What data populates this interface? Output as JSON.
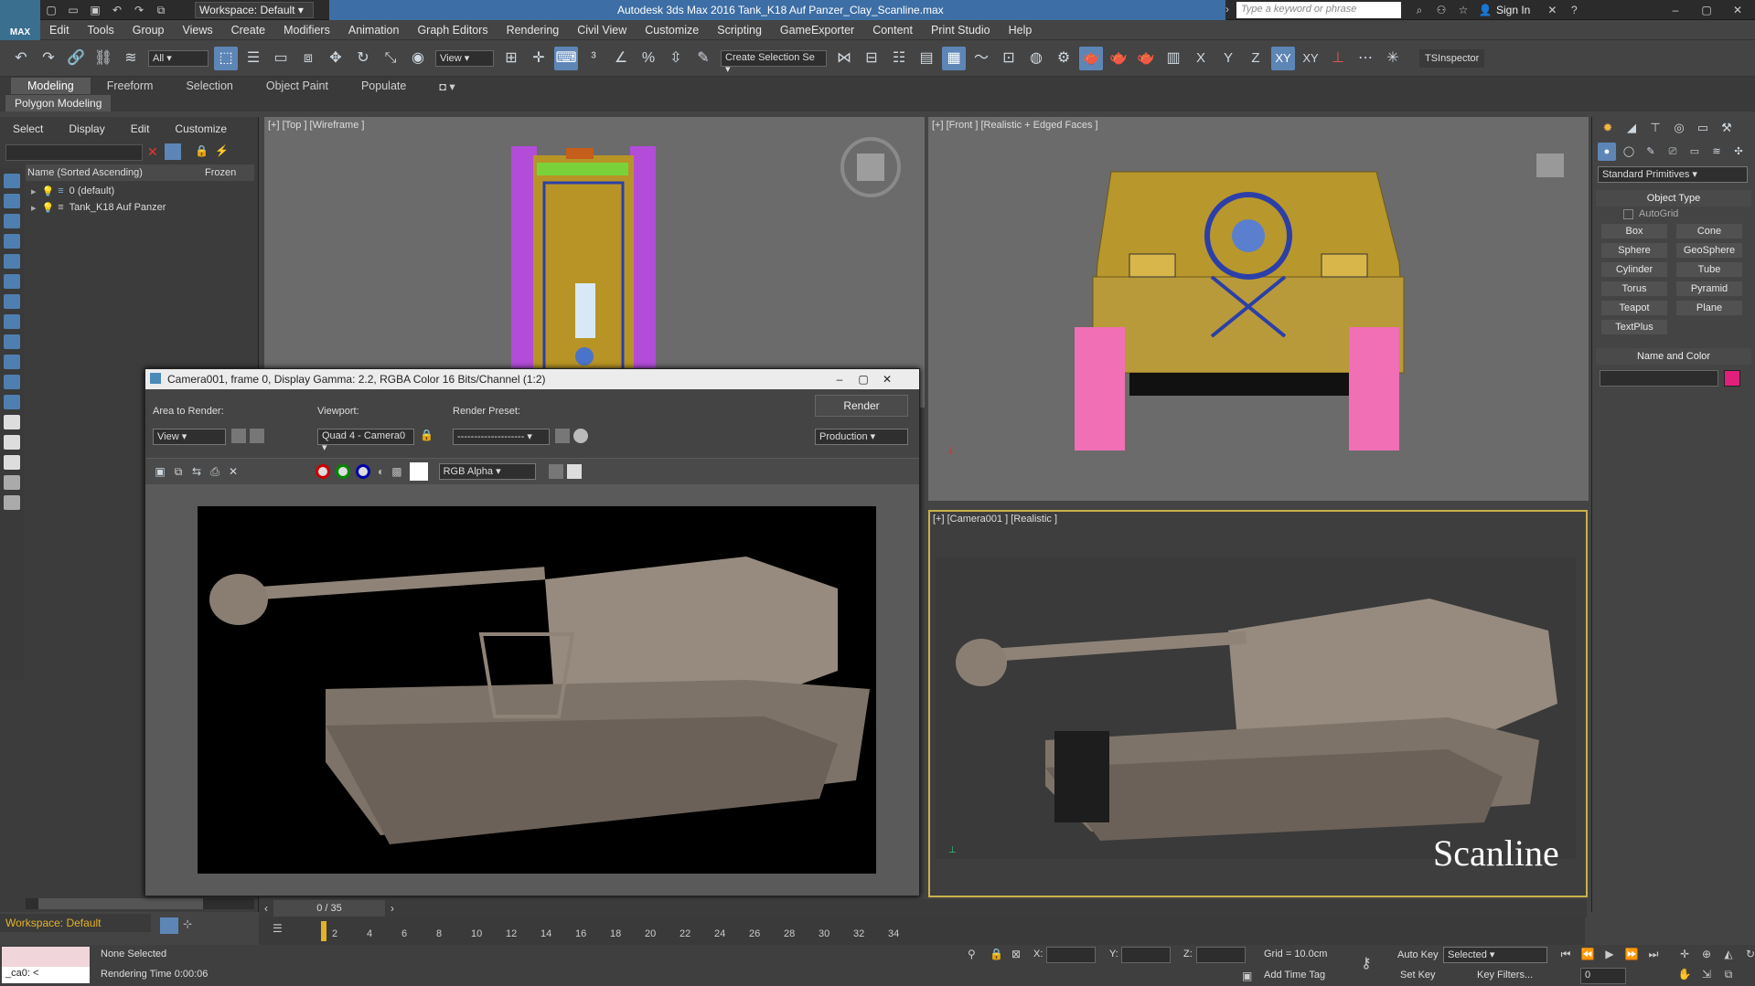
{
  "titlebar": {
    "logo": "MAX",
    "workspace": "Workspace: Default",
    "title": "Autodesk 3ds Max 2016    Tank_K18 Auf Panzer_Clay_Scanline.max",
    "search_placeholder": "Type a keyword or phrase",
    "sign_in": "Sign In"
  },
  "menus": [
    "Edit",
    "Tools",
    "Group",
    "Views",
    "Create",
    "Modifiers",
    "Animation",
    "Graph Editors",
    "Rendering",
    "Civil View",
    "Customize",
    "Scripting",
    "GameExporter",
    "Content",
    "Print Studio",
    "Help"
  ],
  "toolbar": {
    "filter": "All",
    "ref_coord": "View",
    "selection_set": "Create Selection Se",
    "axes": [
      "X",
      "Y",
      "Z",
      "XY",
      "XY"
    ],
    "tsinspector": "TSInspector"
  },
  "ribbon": {
    "tabs": [
      "Modeling",
      "Freeform",
      "Selection",
      "Object Paint",
      "Populate"
    ],
    "sub": "Polygon Modeling"
  },
  "scene_explorer": {
    "menus": [
      "Select",
      "Display",
      "Edit",
      "Customize"
    ],
    "col_name": "Name (Sorted Ascending)",
    "col_frozen": "Frozen",
    "rows": [
      "0 (default)",
      "Tank_K18 Auf Panzer"
    ]
  },
  "viewports": {
    "top": "[+] [Top ] [Wireframe ]",
    "front": "[+] [Front ] [Realistic + Edged Faces ]",
    "camera": "[+] [Camera001 ] [Realistic ]",
    "camera_overlay": "Scanline"
  },
  "render_window": {
    "title": "Camera001, frame 0, Display Gamma: 2.2, RGBA Color 16 Bits/Channel (1:2)",
    "area_label": "Area to Render:",
    "area_value": "View",
    "viewport_label": "Viewport:",
    "viewport_value": "Quad 4 - Camera0",
    "preset_label": "Render Preset:",
    "preset_value": "--------------------",
    "render_button": "Render",
    "production": "Production",
    "channel": "RGB Alpha"
  },
  "command_panel": {
    "category": "Standard Primitives",
    "object_type_header": "Object Type",
    "autogrid": "AutoGrid",
    "primitives": [
      "Box",
      "Cone",
      "Sphere",
      "GeoSphere",
      "Cylinder",
      "Tube",
      "Torus",
      "Pyramid",
      "Teapot",
      "Plane",
      "TextPlus"
    ],
    "name_color_header": "Name and Color",
    "object_color": "#e0207a"
  },
  "timeline": {
    "frame_counter": "0 / 35",
    "ticks": [
      "2",
      "4",
      "6",
      "8",
      "10",
      "12",
      "14",
      "16",
      "18",
      "20",
      "22",
      "24",
      "26",
      "28",
      "30",
      "32",
      "34"
    ]
  },
  "status": {
    "workspace": "Workspace: Default",
    "selection": "None Selected",
    "render_time": "Rendering Time  0:00:06",
    "maxscript": "_ca0: <",
    "x_label": "X:",
    "y_label": "Y:",
    "z_label": "Z:",
    "grid": "Grid = 10.0cm",
    "add_time_tag": "Add Time Tag",
    "auto_key": "Auto Key",
    "auto_key_value": "Selected",
    "set_key": "Set Key",
    "key_filters": "Key Filters...",
    "frame": "0"
  }
}
